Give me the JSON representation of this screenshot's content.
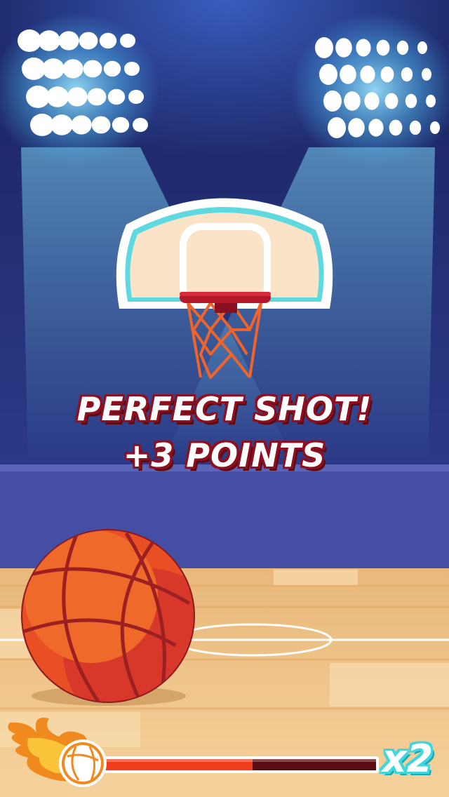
{
  "game": {
    "message_line1": "PERFECT SHOT!",
    "message_line2": "+3 POINTS",
    "multiplier": "x2",
    "power_meter_level": 0.55
  },
  "colors": {
    "sky_top": "#1e2a66",
    "sky_bottom": "#2d3b86",
    "wall": "#444ea4",
    "floor": "#f0c58a",
    "ball": "#e84f24",
    "rim": "#b6182b",
    "net": "#f0642a",
    "backboard_border": "#5fd9e0",
    "text_outline": "#8e1020",
    "meter_fill": "#f23d1c",
    "meter_empty": "#5a0c12",
    "multiplier_outline": "#3fd6de"
  },
  "icons": {
    "flame_ball": "flaming-basketball-icon",
    "stadium_lights": "floodlight-icon"
  }
}
